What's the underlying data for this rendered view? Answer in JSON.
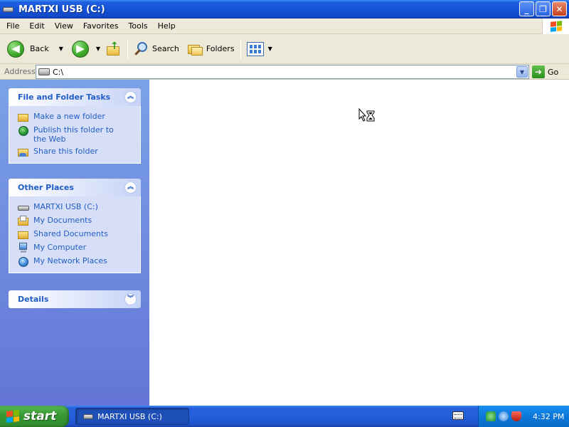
{
  "window": {
    "title": "MARTXI USB (C:)",
    "buttons": {
      "minimize": "_",
      "maximize": "❐",
      "close": "✕"
    }
  },
  "menu": {
    "items": [
      "File",
      "Edit",
      "View",
      "Favorites",
      "Tools",
      "Help"
    ]
  },
  "toolbar": {
    "back_label": "Back",
    "search_label": "Search",
    "folders_label": "Folders"
  },
  "address": {
    "label": "Address",
    "value": "C:\\",
    "go_label": "Go"
  },
  "taskpane": {
    "file_tasks": {
      "title": "File and Folder Tasks",
      "items": [
        {
          "label": "Make a new folder",
          "icon": "new-folder-icon"
        },
        {
          "label": "Publish this folder to the Web",
          "icon": "publish-web-icon"
        },
        {
          "label": "Share this folder",
          "icon": "share-folder-icon"
        }
      ]
    },
    "other_places": {
      "title": "Other Places",
      "items": [
        {
          "label": "MARTXI USB (C:)",
          "icon": "drive-icon"
        },
        {
          "label": "My Documents",
          "icon": "my-documents-icon"
        },
        {
          "label": "Shared Documents",
          "icon": "shared-documents-icon"
        },
        {
          "label": "My Computer",
          "icon": "my-computer-icon"
        },
        {
          "label": "My Network Places",
          "icon": "network-places-icon"
        }
      ]
    },
    "details": {
      "title": "Details"
    }
  },
  "taskbar": {
    "start_label": "start",
    "window_button": "MARTXI USB (C:)",
    "clock": "4:32 PM"
  },
  "colors": {
    "titlebar": "#1553d6",
    "taskpane_link": "#215dc6",
    "start_green": "#3a9a36",
    "tray_blue": "#0b77d9"
  }
}
